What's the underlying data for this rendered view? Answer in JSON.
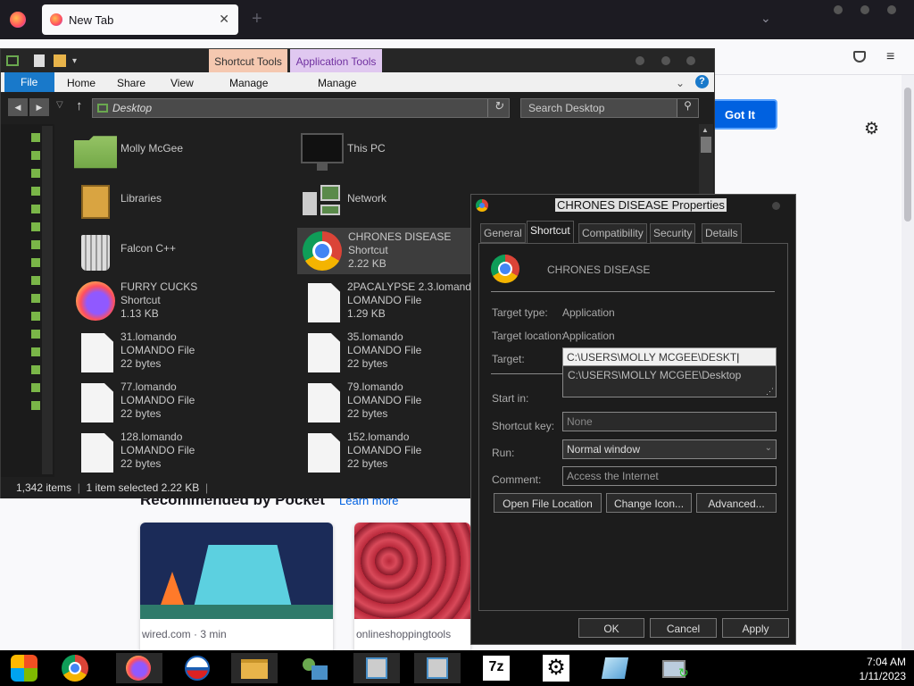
{
  "browser": {
    "tab_title": "New Tab",
    "new_tab_symbol": "+",
    "got_it_label": "Got It",
    "pocket_title": "Recommended by Pocket",
    "pocket_learn_more": "Learn more",
    "cards": [
      {
        "source": "wired.com · 3 min"
      },
      {
        "source": "onlineshoppingtools"
      }
    ]
  },
  "explorer": {
    "ribbon": {
      "context_tabs": [
        "Shortcut Tools",
        "Application Tools"
      ],
      "tabs": [
        "File",
        "Home",
        "Share",
        "View",
        "Manage",
        "Manage"
      ]
    },
    "address": "Desktop",
    "search_placeholder": "Search Desktop",
    "items": [
      {
        "name": "Molly McGee",
        "type": "",
        "size": ""
      },
      {
        "name": "This PC",
        "type": "",
        "size": ""
      },
      {
        "name": "Libraries",
        "type": "",
        "size": ""
      },
      {
        "name": "Network",
        "type": "",
        "size": ""
      },
      {
        "name": "Falcon C++",
        "type": "",
        "size": ""
      },
      {
        "name": "CHRONES DISEASE",
        "type": "Shortcut",
        "size": "2.22 KB"
      },
      {
        "name": "FURRY CUCKS",
        "type": "Shortcut",
        "size": "1.13 KB"
      },
      {
        "name": "2PACALYPSE 2.3.lomando",
        "type": "LOMANDO File",
        "size": "1.29 KB"
      },
      {
        "name": "31.lomando",
        "type": "LOMANDO File",
        "size": "22 bytes"
      },
      {
        "name": "35.lomando",
        "type": "LOMANDO File",
        "size": "22 bytes"
      },
      {
        "name": "77.lomando",
        "type": "LOMANDO File",
        "size": "22 bytes"
      },
      {
        "name": "79.lomando",
        "type": "LOMANDO File",
        "size": "22 bytes"
      },
      {
        "name": "128.lomando",
        "type": "LOMANDO File",
        "size": "22 bytes"
      },
      {
        "name": "152.lomando",
        "type": "LOMANDO File",
        "size": "22 bytes"
      }
    ],
    "status": {
      "count": "1,342 items",
      "selected": "1 item selected  2.22 KB"
    }
  },
  "properties": {
    "title": "CHRONES DISEASE Properties",
    "tabs": [
      "General",
      "Shortcut",
      "Compatibility",
      "Security",
      "Details"
    ],
    "name": "CHRONES DISEASE",
    "labels": {
      "target_type": "Target type:",
      "target_location": "Target location:",
      "target": "Target:",
      "start_in": "Start in:",
      "shortcut_key": "Shortcut key:",
      "run": "Run:",
      "comment": "Comment:"
    },
    "values": {
      "target_type": "Application",
      "target_location": "Application",
      "target": "C:\\USERS\\MOLLY MCGEE\\DESKT",
      "autocomplete": "C:\\USERS\\MOLLY MCGEE\\Desktop",
      "shortcut_key": "None",
      "run": "Normal window",
      "comment": "Access the Internet"
    },
    "buttons": {
      "open_location": "Open File Location",
      "change_icon": "Change Icon...",
      "advanced": "Advanced...",
      "ok": "OK",
      "cancel": "Cancel",
      "apply": "Apply"
    }
  },
  "taskbar": {
    "apps": [
      "windows-start",
      "chrome",
      "firefox",
      "obama-logo",
      "file-explorer",
      "network-users",
      "remote-install",
      "remote-install-2",
      "7zip",
      "settings-gear",
      "paint",
      "network-refresh"
    ],
    "label_7z": "7z",
    "time": "7:04 AM",
    "date": "1/11/2023"
  },
  "colors": {
    "accent": "#0061e0",
    "ribbon_file": "#1979ca",
    "shortcut_tools": "#f5c8b0",
    "application_tools": "#e0c8f0"
  }
}
